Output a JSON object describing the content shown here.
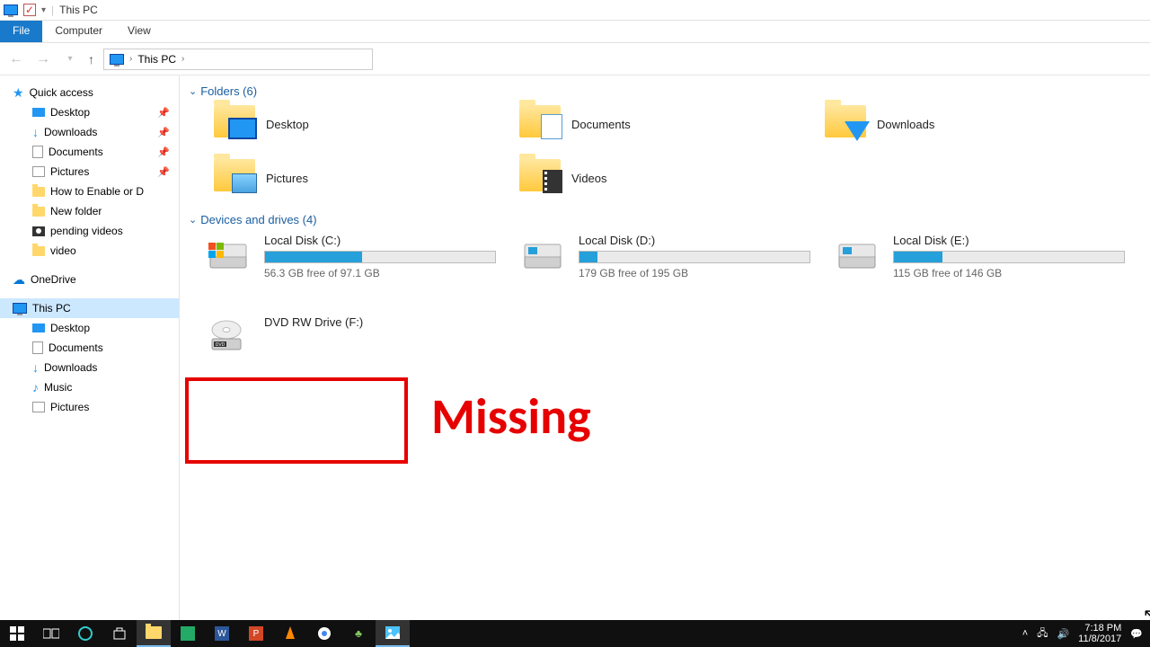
{
  "titlebar": {
    "title": "This PC"
  },
  "ribbon": {
    "file": "File",
    "computer": "Computer",
    "view": "View"
  },
  "address": {
    "location": "This PC",
    "chevron": "›"
  },
  "sidebar": {
    "quick_access": "Quick access",
    "qa": [
      {
        "label": "Desktop",
        "pinned": true
      },
      {
        "label": "Downloads",
        "pinned": true
      },
      {
        "label": "Documents",
        "pinned": true
      },
      {
        "label": "Pictures",
        "pinned": true
      },
      {
        "label": "How to Enable or D",
        "pinned": false
      },
      {
        "label": "New folder",
        "pinned": false
      },
      {
        "label": "pending videos",
        "pinned": false
      },
      {
        "label": "video",
        "pinned": false
      }
    ],
    "onedrive": "OneDrive",
    "thispc": "This PC",
    "pc": [
      {
        "label": "Desktop"
      },
      {
        "label": "Documents"
      },
      {
        "label": "Downloads"
      },
      {
        "label": "Music"
      },
      {
        "label": "Pictures"
      }
    ]
  },
  "groups": {
    "folders_head": "Folders (6)",
    "drives_head": "Devices and drives (4)"
  },
  "folders": [
    {
      "label": "Desktop",
      "kind": "desktop"
    },
    {
      "label": "Documents",
      "kind": "doc"
    },
    {
      "label": "Downloads",
      "kind": "down"
    },
    {
      "label": "Pictures",
      "kind": "pic"
    },
    {
      "label": "Videos",
      "kind": "vid"
    }
  ],
  "drives": [
    {
      "name": "Local Disk (C:)",
      "free": "56.3 GB free of 97.1 GB",
      "pct": 42
    },
    {
      "name": "Local Disk (D:)",
      "free": "179 GB free of 195 GB",
      "pct": 8
    },
    {
      "name": "Local Disk (E:)",
      "free": "115 GB free of 146 GB",
      "pct": 21
    },
    {
      "name": "DVD RW Drive (F:)",
      "free": "",
      "pct": 0,
      "dvd": true
    }
  ],
  "annotation": {
    "missing": "Missing"
  },
  "taskbar": {
    "time": "7:18 PM",
    "date": "11/8/2017"
  }
}
